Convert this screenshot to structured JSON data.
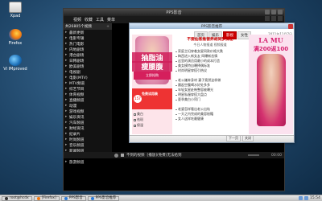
{
  "desktop": {
    "icons": [
      {
        "label": "Xpad",
        "icon": "notepad-icon"
      },
      {
        "label": "Firefox",
        "icon": "firefox-icon"
      },
      {
        "label": "Vi IMproved",
        "icon": "vim-icon"
      }
    ]
  },
  "player": {
    "title": "PPS影音",
    "menu": [
      "视频",
      "收藏",
      "工具",
      "菜单"
    ],
    "sidebar": {
      "header": "共26805个视频",
      "plus": "+",
      "items": [
        "最新更新",
        "电影专辑",
        "热门电影",
        "内地剧场",
        "港台剧场",
        "日韩剧场",
        "欧美剧场",
        "电视剧",
        "电影(MTV)",
        "MTV频道",
        "综艺节目",
        "体育视频",
        "直播频道",
        "动漫",
        "游戏视频",
        "娱乐资讯",
        "汽车频道",
        "财经资讯",
        "纪录片",
        "时尚频道",
        "音乐频道",
        "新闻频道",
        "教育频道",
        "旅游频道"
      ]
    },
    "status": "不到的视频",
    "now_playing": "[播放](免费)无法给到",
    "time": "00:00"
  },
  "popup": {
    "title": "PPS影音推荐",
    "tabs": [
      "首页",
      "娱乐",
      "影视",
      "女性"
    ],
    "active_tab": 2,
    "date": "2011年11月7日",
    "news_headline": "不要仙客推营养胡同梦探秘",
    "news_sub": "今日人物报道 视频报道",
    "news_group1": [
      "家庭主妇穿着女星同款价格大跌",
      "梅西进入新女友 网曝新恋情",
      "这里的演员用最小的成本打造",
      "美女模特自曝择偶标准",
      "时尚明星穿搭引热议"
    ],
    "news_group2": [
      "老公嫌弃身材 妻子竟然这样做",
      "晨起空腹喝水好处多多",
      "年轻女星赴韩整容被曝光",
      "明星私服穿搭大盘点",
      "夏季美白小窍门"
    ],
    "news_group3": [
      "老婆怎样看出老公出轨",
      "一天之内完成的美容秘籍",
      "女人这样吃最健康"
    ],
    "ad_left": {
      "headline_line1": "抽脂油",
      "headline_line2": "瘦腰腹",
      "buy_label": "立即抢购",
      "banner_text": "免费试用装",
      "badge": "157",
      "checks": [
        "美白",
        "祛斑",
        "保湿"
      ]
    },
    "ad_right": {
      "brand": "LA MU",
      "promo": "满200返100"
    },
    "footer": [
      "下一页",
      "关闭"
    ]
  },
  "taskbar": {
    "items": [
      {
        "label": "root@hcdx",
        "icon": "terminal-icon",
        "color": "#333333"
      },
      {
        "label": "[Firefox]",
        "icon": "firefox-icon",
        "color": "#f07a12"
      },
      {
        "label": "PPS影音",
        "icon": "pps-icon",
        "color": "#2b7ad8"
      },
      {
        "label": "PPS影音推荐",
        "icon": "pps-icon",
        "color": "#2b7ad8"
      }
    ],
    "clock": "15:54"
  }
}
